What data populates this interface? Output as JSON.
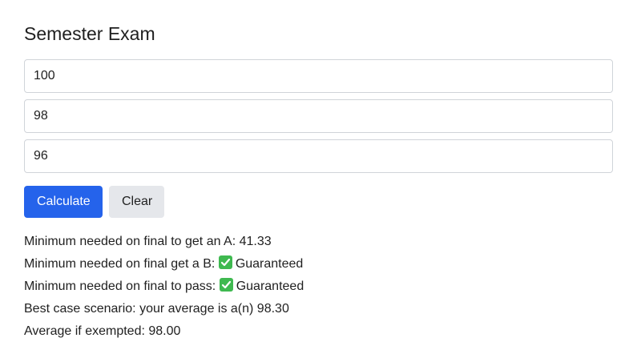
{
  "page": {
    "title": "Semester Exam"
  },
  "inputs": [
    {
      "value": "100"
    },
    {
      "value": "98"
    },
    {
      "value": "96"
    }
  ],
  "buttons": {
    "calculate_label": "Calculate",
    "clear_label": "Clear"
  },
  "results": {
    "line_a_label": "Minimum needed on final to get an A:",
    "line_a_value": "41.33",
    "line_b_label": "Minimum needed on final get a B:",
    "line_b_value": "Guaranteed",
    "line_pass_label": "Minimum needed on final to pass:",
    "line_pass_value": "Guaranteed",
    "best_case": "Best case scenario: your average is a(n) 98.30",
    "exempted": "Average if exempted: 98.00"
  },
  "icons": {
    "guaranteed_icon": "check-icon"
  },
  "colors": {
    "primary": "#2563eb",
    "secondary_button": "#e5e7eb",
    "input_border": "#d0d4d9",
    "check": "#3fb950"
  }
}
